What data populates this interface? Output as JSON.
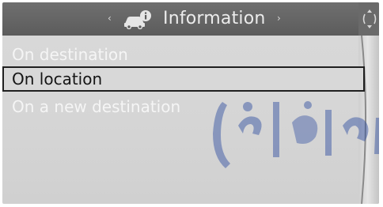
{
  "header": {
    "title": "Information",
    "left_arrow": "‹",
    "right_arrow": "›",
    "icon": "car-info-icon"
  },
  "side_control": {
    "icon": "controller-icon"
  },
  "menu": {
    "items": [
      {
        "label": "On destination",
        "selected": false
      },
      {
        "label": "On location",
        "selected": true
      },
      {
        "label": "On a new destination",
        "selected": false
      }
    ]
  },
  "watermark": {
    "text": "فارما رو"
  },
  "colors": {
    "header_bg": "#5c5c5c",
    "panel_bg": "#d5d5d5",
    "item_text": "#f5f5f5",
    "selected_border": "#1f1f1f",
    "watermark": "#2b4aa0"
  }
}
